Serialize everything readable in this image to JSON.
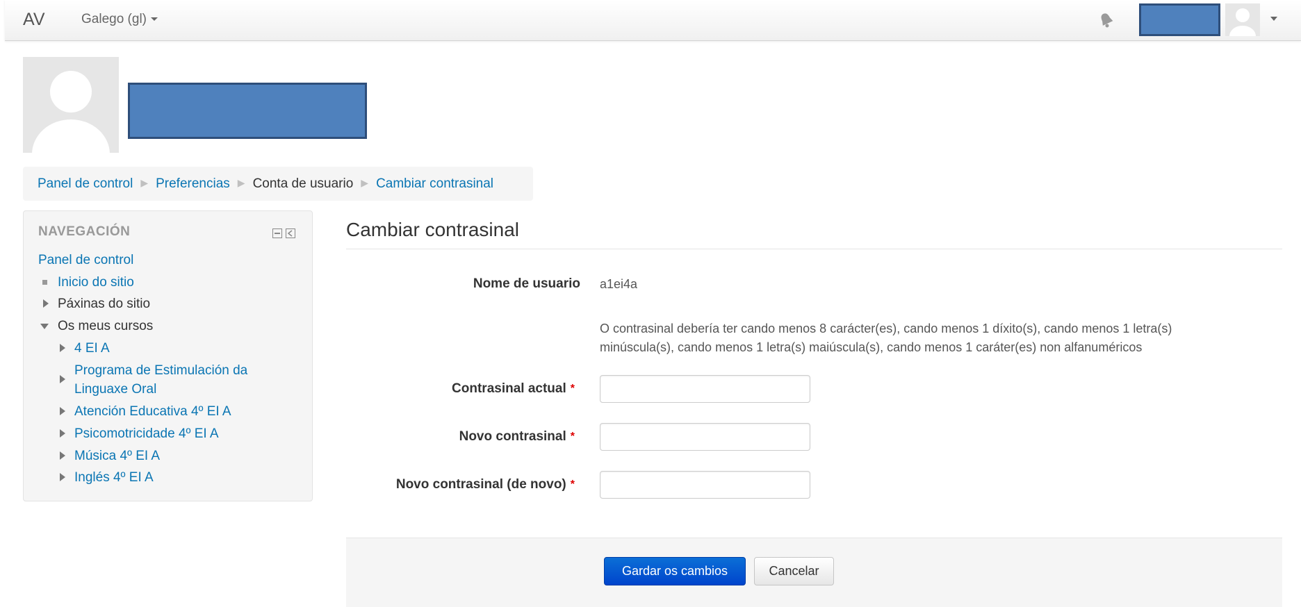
{
  "navbar": {
    "brand": "AV",
    "language": "Galego (gl)"
  },
  "breadcrumb": {
    "items": [
      "Panel de control",
      "Preferencias",
      "Conta de usuario",
      "Cambiar contrasinal"
    ]
  },
  "navigation": {
    "title": "NAVEGACIÓN",
    "root": "Panel de control",
    "site_home": "Inicio do sitio",
    "site_pages": "Páxinas do sitio",
    "my_courses": "Os meus cursos",
    "courses": [
      "4 EI A",
      "Programa de Estimulación da",
      "Linguaxe Oral",
      "Atención Educativa 4º EI A",
      "Psicomotricidade 4º EI A",
      "Música 4º EI A",
      "Inglés 4º EI A"
    ]
  },
  "main": {
    "title": "Cambiar contrasinal",
    "username_label": "Nome de usuario",
    "username_value": "a1ei4a",
    "policy_line1": "O contrasinal debería ter cando menos 8 carácter(es), cando menos 1 díxito(s), cando menos 1 letra(s)",
    "policy_line2": "minúscula(s), cando menos 1 letra(s) maiúscula(s), cando menos 1 caráter(es) non alfanuméricos",
    "current_password_label": "Contrasinal actual",
    "new_password_label": "Novo contrasinal",
    "new_password_again_label": "Novo contrasinal (de novo)",
    "required_marker": "*",
    "current_password_value": "",
    "new_password_value": "",
    "new_password_again_value": "",
    "save_label": "Gardar os cambios",
    "cancel_label": "Cancelar"
  },
  "colors": {
    "link": "#0a75b3",
    "primary_button": "#0044cc",
    "redaction": "#4f81bd",
    "required": "#dd0000"
  }
}
